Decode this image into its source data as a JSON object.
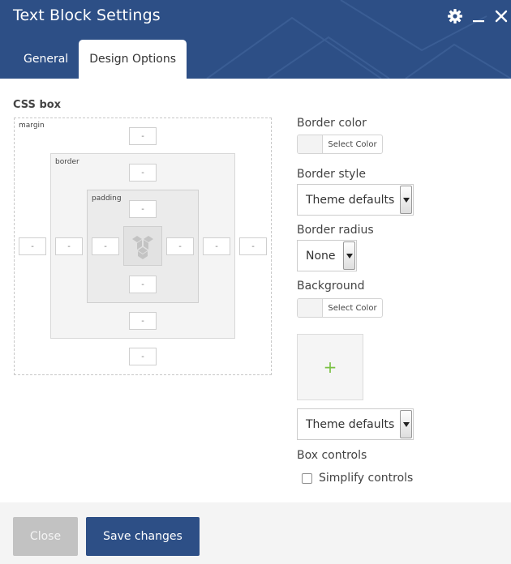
{
  "window": {
    "title": "Text Block Settings"
  },
  "tabs": [
    {
      "label": "General",
      "active": false
    },
    {
      "label": "Design Options",
      "active": true
    }
  ],
  "css_box": {
    "title": "CSS box",
    "margin_label": "margin",
    "border_label": "border",
    "padding_label": "padding",
    "margin": {
      "top": "-",
      "right": "-",
      "bottom": "-",
      "left": "-"
    },
    "border": {
      "top": "-",
      "right": "-",
      "bottom": "-",
      "left": "-"
    },
    "padding": {
      "top": "-",
      "right": "-",
      "bottom": "-",
      "left": "-"
    }
  },
  "border_color": {
    "label": "Border color",
    "button": "Select Color"
  },
  "border_style": {
    "label": "Border style",
    "value": "Theme defaults"
  },
  "border_radius": {
    "label": "Border radius",
    "value": "None"
  },
  "background": {
    "label": "Background",
    "button": "Select Color",
    "image_add": "+",
    "style_value": "Theme defaults"
  },
  "box_controls": {
    "label": "Box controls",
    "simplify_label": "Simplify controls",
    "simplify_checked": false
  },
  "footer": {
    "close_label": "Close",
    "save_label": "Save changes"
  },
  "colors": {
    "header_bg": "#2d4f86",
    "accent_green": "#7ac143",
    "close_bg": "#c2c2c2",
    "footer_bg": "#f4f4f4"
  },
  "icons": {
    "settings": "gear-icon",
    "minimize": "minimize-icon",
    "close": "close-icon",
    "logo": "vc-logo-icon",
    "dropdown": "chevron-down-icon"
  }
}
